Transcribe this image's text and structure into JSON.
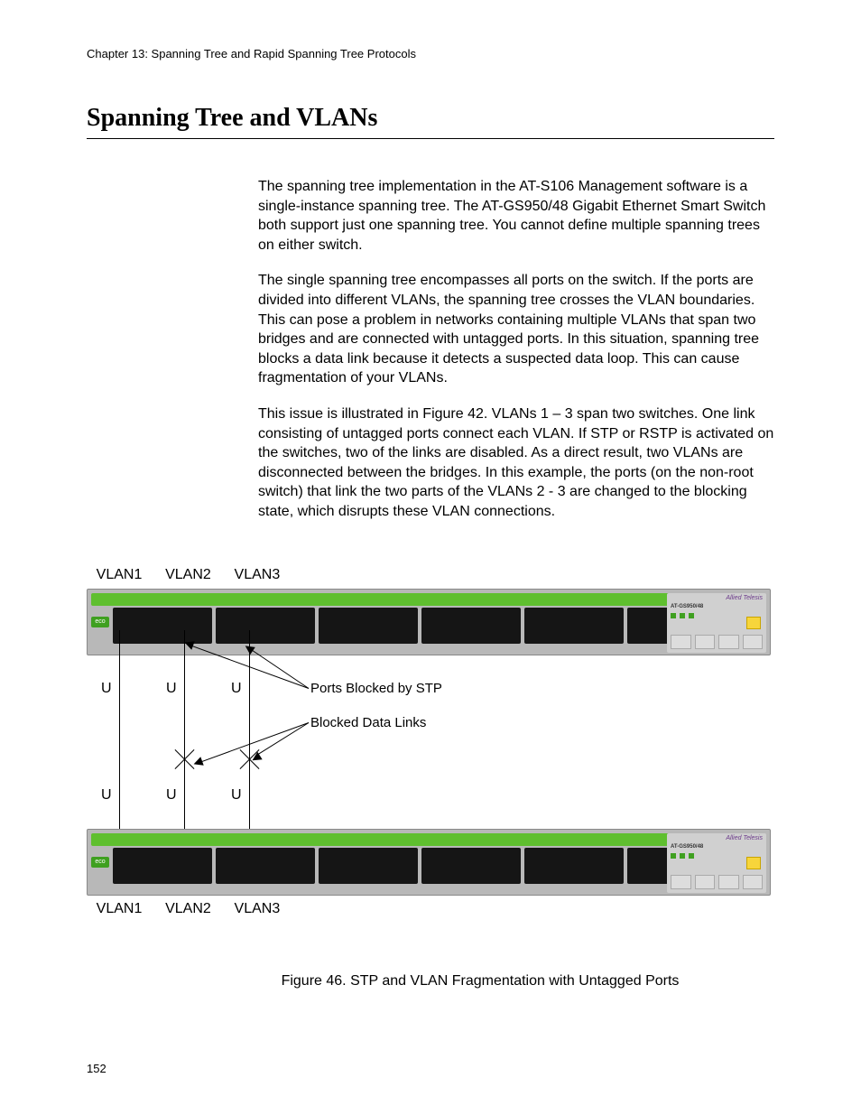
{
  "header": {
    "chapter_line": "Chapter 13: Spanning Tree and Rapid Spanning Tree Protocols"
  },
  "section": {
    "title": "Spanning Tree and VLANs",
    "paragraphs": [
      "The spanning tree implementation in the AT-S106 Management software is a single-instance spanning tree. The AT-GS950/48 Gigabit Ethernet Smart Switch both support just one spanning tree. You cannot define multiple spanning trees on either switch.",
      "The single spanning tree encompasses all ports on the switch. If the ports are divided into different VLANs, the spanning tree crosses the VLAN boundaries. This can pose a problem in networks containing multiple VLANs that span two bridges and are connected with untagged ports. In this situation, spanning tree blocks a data link because it detects a suspected data loop. This can cause fragmentation of your VLANs.",
      "This issue is illustrated in Figure 42. VLANs 1 – 3 span two switches. One link consisting of untagged ports connect each VLAN. If STP or RSTP is activated on the switches, two of the links are disabled. As a direct result, two VLANs are disconnected between the bridges. In this example, the ports (on the non-root switch) that link the two parts of the VLANs 2 - 3 are changed to the blocking state, which disrupts these VLAN connections."
    ]
  },
  "figure": {
    "vlan_labels": [
      "VLAN1",
      "VLAN2",
      "VLAN3"
    ],
    "u_label": "U",
    "annotation_ports_blocked": "Ports Blocked by STP",
    "annotation_blocked_links": "Blocked Data Links",
    "caption": "Figure 46. STP and VLAN Fragmentation with Untagged Ports",
    "switch_brand": "Allied Telesis",
    "switch_model": "AT-GS950/48",
    "eco_label": "eco"
  },
  "footer": {
    "page_number": "152"
  }
}
